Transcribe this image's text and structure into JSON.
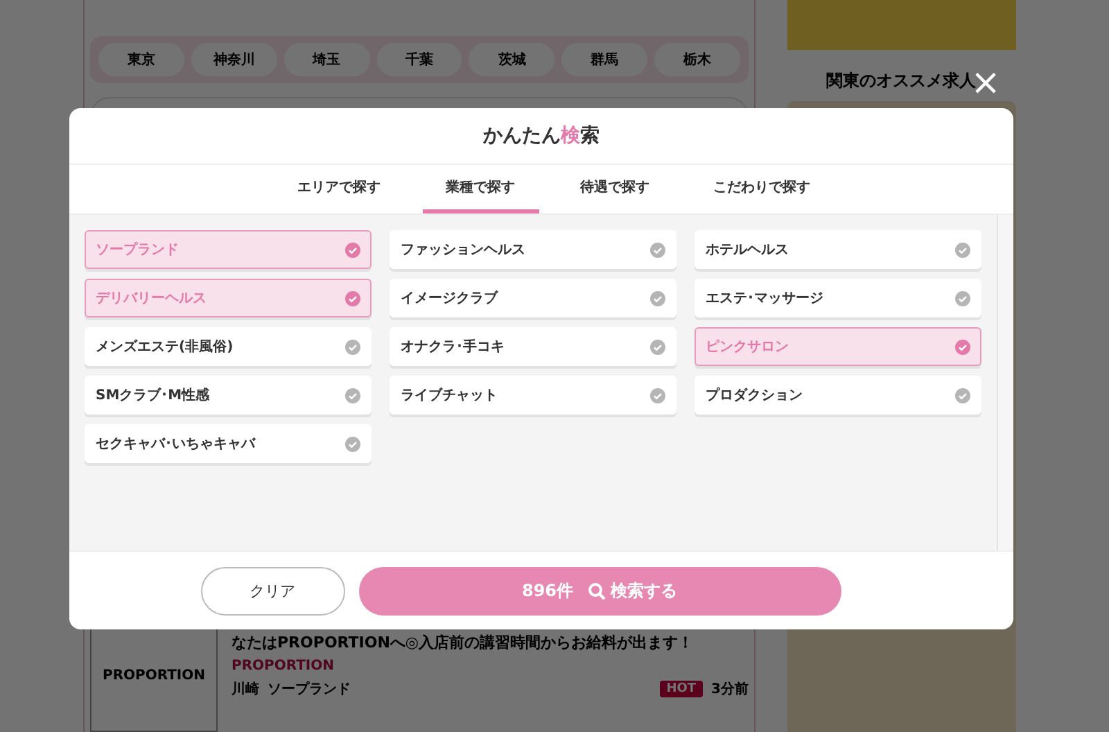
{
  "background": {
    "prefectures": [
      "東京",
      "神奈川",
      "埼玉",
      "千葉",
      "茨城",
      "群馬",
      "栃木"
    ],
    "sidebar_heading": "関東のオススメ求人",
    "listing": {
      "logo_text": "PROPORTION",
      "title": "なたはPROPORTIONへ◎入店前の講習時間からお給料が出ます！",
      "shop": "PROPORTION",
      "area": "川崎",
      "category": "ソープランド",
      "badge": "HOT",
      "time": "3分前"
    }
  },
  "modal": {
    "close": "×",
    "title": [
      {
        "text": "かんたん",
        "accent": false
      },
      {
        "text": "検",
        "accent": true
      },
      {
        "text": "索",
        "accent": false
      }
    ],
    "tabs": [
      {
        "label": "エリアで探す",
        "selected": false
      },
      {
        "label": "業種で探す",
        "selected": true
      },
      {
        "label": "待遇で探す",
        "selected": false
      },
      {
        "label": "こだわりで探す",
        "selected": false
      }
    ],
    "columns": [
      [
        {
          "label": "ソープランド",
          "checked": true
        },
        {
          "label": "デリバリーヘルス",
          "checked": true
        },
        {
          "label": "メンズエステ(非風俗)",
          "checked": false
        },
        {
          "label": "SMクラブ･M性感",
          "checked": false
        },
        {
          "label": "セクキャバ･いちゃキャバ",
          "checked": false
        }
      ],
      [
        {
          "label": "ファッションヘルス",
          "checked": false
        },
        {
          "label": "イメージクラブ",
          "checked": false
        },
        {
          "label": "オナクラ･手コキ",
          "checked": false
        },
        {
          "label": "ライブチャット",
          "checked": false
        }
      ],
      [
        {
          "label": "ホテルヘルス",
          "checked": false
        },
        {
          "label": "エステ･マッサージ",
          "checked": false
        },
        {
          "label": "ピンクサロン",
          "checked": true
        },
        {
          "label": "プロダクション",
          "checked": false
        }
      ]
    ],
    "clear_button": "クリア",
    "count": "896件",
    "search_button": "検索する"
  }
}
